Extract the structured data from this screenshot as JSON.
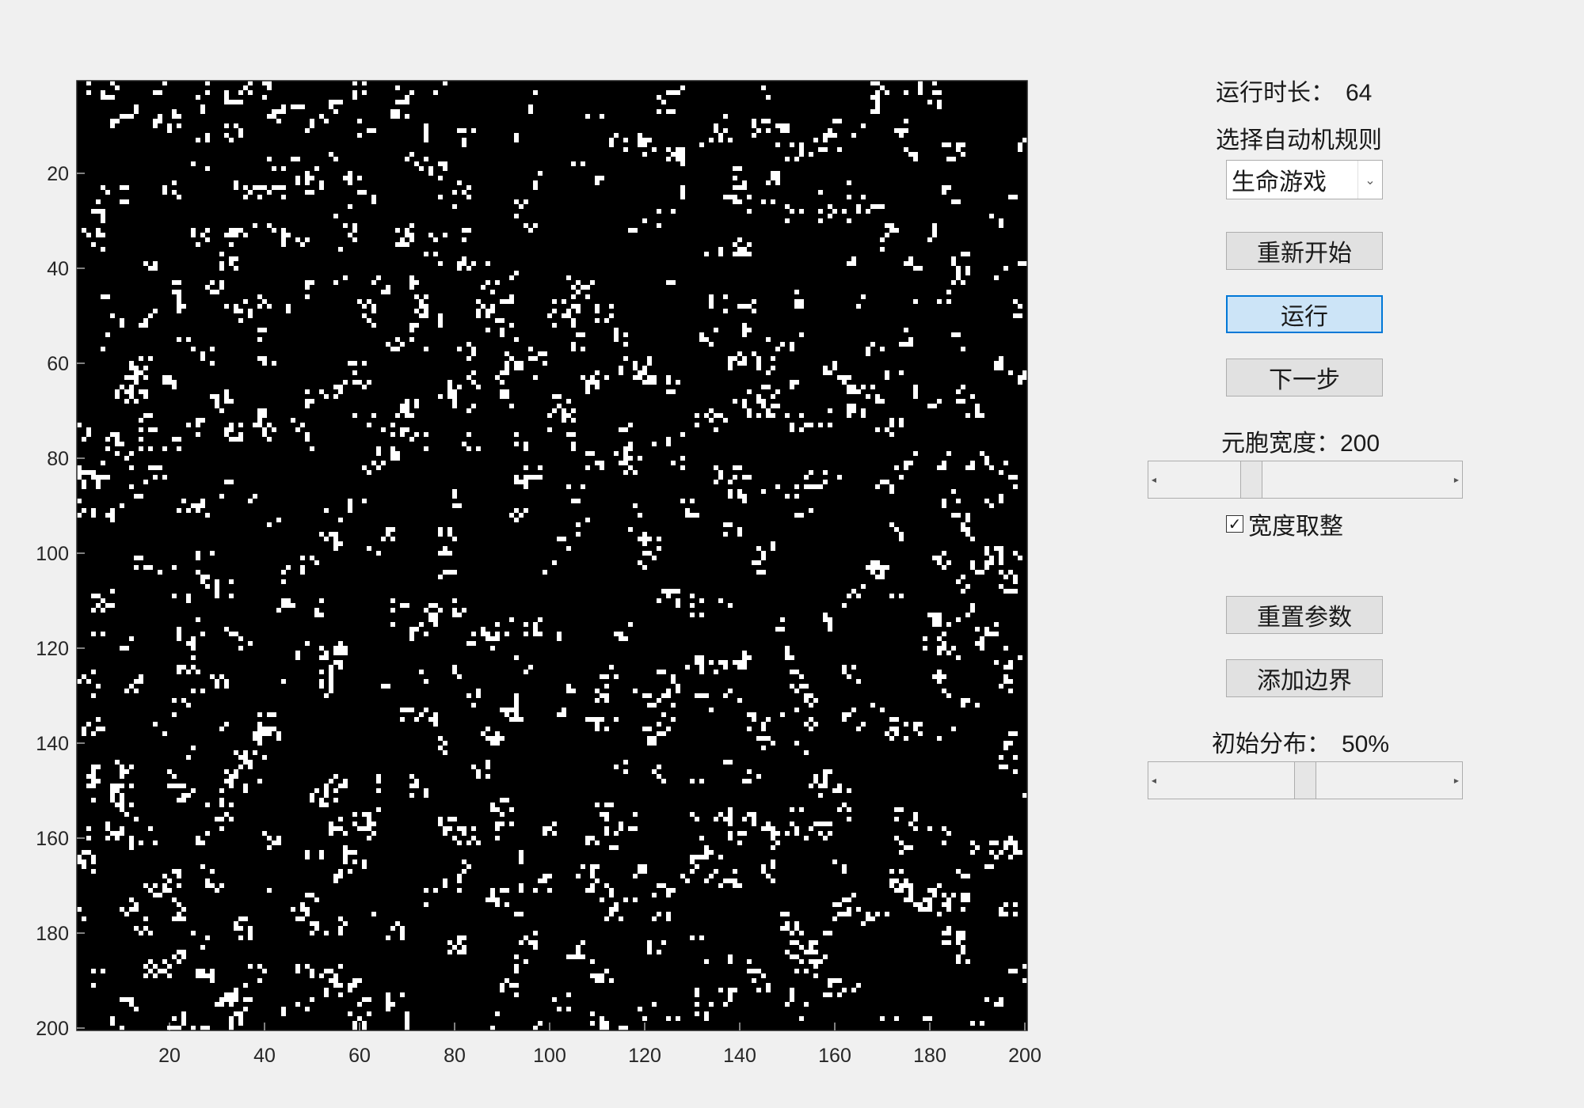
{
  "grid": {
    "size": 200,
    "live_fraction": 0.17,
    "seed": 64,
    "xlim": [
      0.5,
      200.5
    ],
    "ylim": [
      0.5,
      200.5
    ],
    "x_ticks": [
      20,
      40,
      60,
      80,
      100,
      120,
      140,
      160,
      180,
      200
    ],
    "y_ticks": [
      20,
      40,
      60,
      80,
      100,
      120,
      140,
      160,
      180,
      200
    ],
    "y_reversed": true,
    "colors": {
      "alive": "#ffffff",
      "dead": "#000000"
    }
  },
  "controls": {
    "runtime_label": "运行时长：",
    "runtime_value": "64",
    "rule_label": "选择自动机规则",
    "rule_selected": "生命游戏",
    "restart_button": "重新开始",
    "run_button": "运行",
    "next_button": "下一步",
    "cell_width_label": "元胞宽度：",
    "cell_width_value": "200",
    "cell_width_slider_fraction": 0.3,
    "round_width_label": "宽度取整",
    "round_width_checked": true,
    "reset_params_button": "重置参数",
    "add_border_button": "添加边界",
    "initial_dist_label": "初始分布：",
    "initial_dist_value": "50%",
    "initial_dist_slider_fraction": 0.5
  },
  "colors": {
    "panel_bg": "#f0f0f0",
    "button_bg": "#e1e1e1",
    "active_button_bg": "#cce4f7",
    "active_button_border": "#0078d7"
  }
}
